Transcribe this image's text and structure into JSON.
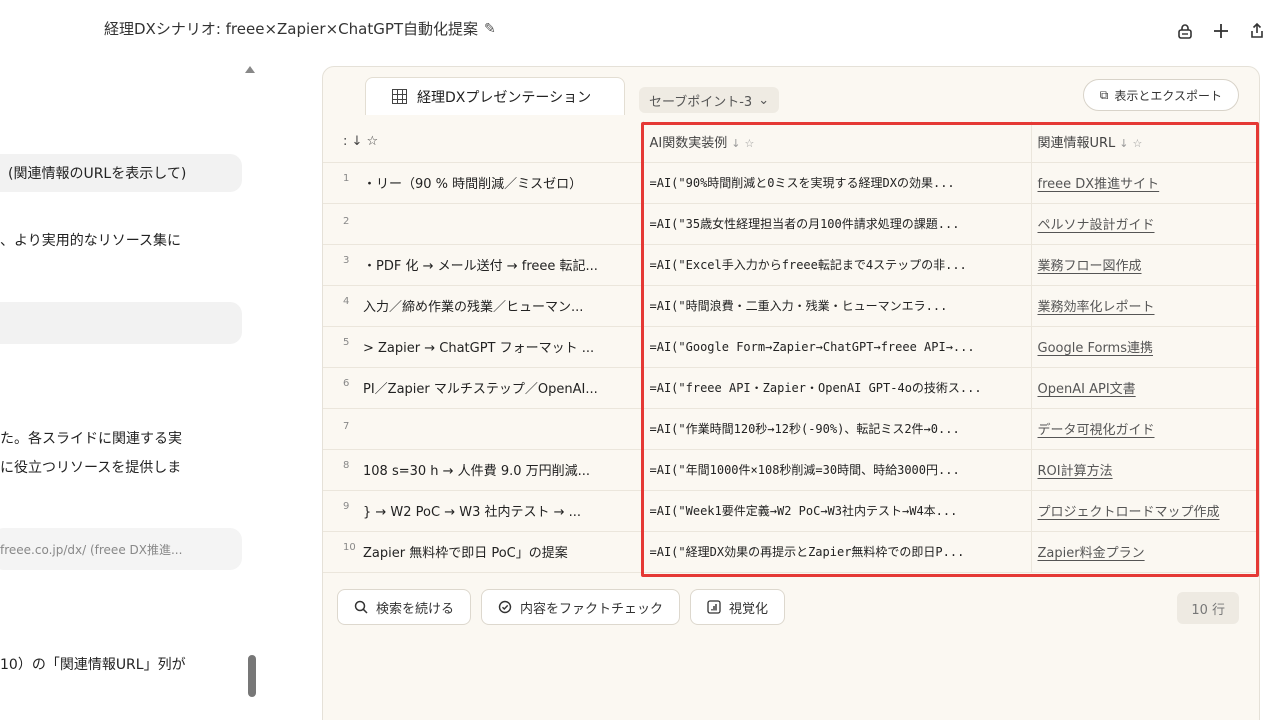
{
  "header": {
    "title": "経理DXシナリオ: freee×Zapier×ChatGPT自動化提案",
    "edit_icon": "✎",
    "lock_icon": "🔒",
    "add_icon": "+",
    "share_icon": "⇪"
  },
  "chat": {
    "bubble1": "(関連情報のURLを表示して)",
    "text1": "、より実用的なリソース集に",
    "bubble2": "",
    "text2a": "た。各スライドに関連する実",
    "text2b": "に役立つリソースを提供しま",
    "faint": "freee.co.jp/dx/ (freee DX推進...",
    "text3": "10）の「関連情報URL」列が"
  },
  "panel": {
    "tab_label": "経理DXプレゼンテーション",
    "savepoint_label": "セーブポイント-3",
    "savepoint_chevron": "⌄",
    "export_icon": "⧉",
    "export_label": "表示とエクスポート",
    "columns": {
      "c0": ": ↓ ☆",
      "c1": "AI関数実装例",
      "c2": "関連情報URL",
      "sort": "↓",
      "pin": "☆"
    },
    "rows": [
      {
        "num": "1",
        "c0": "・リー（90 % 時間削減／ミスゼロ）",
        "c1": "=AI(\"90%時間削減と0ミスを実現する経理DXの効果...",
        "c2": "freee DX推進サイト"
      },
      {
        "num": "2",
        "c0": "",
        "c1": "=AI(\"35歳女性経理担当者の月100件請求処理の課題...",
        "c2": "ペルソナ設計ガイド"
      },
      {
        "num": "3",
        "c0": "・PDF 化 → メール送付 → freee 転記...",
        "c1": "=AI(\"Excel手入力からfreee転記まで4ステップの非...",
        "c2": "業務フロー図作成"
      },
      {
        "num": "4",
        "c0": "入力／締め作業の残業／ヒューマン...",
        "c1": "=AI(\"時間浪費・二重入力・残業・ヒューマンエラ...",
        "c2": "業務効率化レポート"
      },
      {
        "num": "5",
        "c0": "> Zapier → ChatGPT フォーマット ...",
        "c1": "=AI(\"Google Form→Zapier→ChatGPT→freee API→...",
        "c2": "Google Forms連携"
      },
      {
        "num": "6",
        "c0": "PI／Zapier マルチステップ／OpenAI...",
        "c1": "=AI(\"freee API・Zapier・OpenAI GPT-4oの技術ス...",
        "c2": "OpenAI API文書"
      },
      {
        "num": "7",
        "c0": "",
        "c1": "=AI(\"作業時間120秒→12秒(-90%)、転記ミス2件→0...",
        "c2": "データ可視化ガイド"
      },
      {
        "num": "8",
        "c0": "108 s=30 h → 人件費 9.0 万円削減...",
        "c1": "=AI(\"年間1000件×108秒削減=30時間、時給3000円...",
        "c2": "ROI計算方法"
      },
      {
        "num": "9",
        "c0": "} → W2 PoC → W3 社内テスト → ...",
        "c1": "=AI(\"Week1要件定義→W2 PoC→W3社内テスト→W4本...",
        "c2": "プロジェクトロードマップ作成"
      },
      {
        "num": "10",
        "c0": "Zapier 無料枠で即日 PoC」の提案",
        "c1": "=AI(\"経理DX効果の再提示とZapier無料枠での即日P...",
        "c2": "Zapier料金プラン"
      }
    ],
    "actions": {
      "search_icon": "🔍︎",
      "search_label": "検索を続ける",
      "check_icon": "⊘",
      "check_label": "内容をファクトチェック",
      "viz_icon": "▥",
      "viz_label": "視覚化"
    },
    "row_count": "10 行"
  }
}
